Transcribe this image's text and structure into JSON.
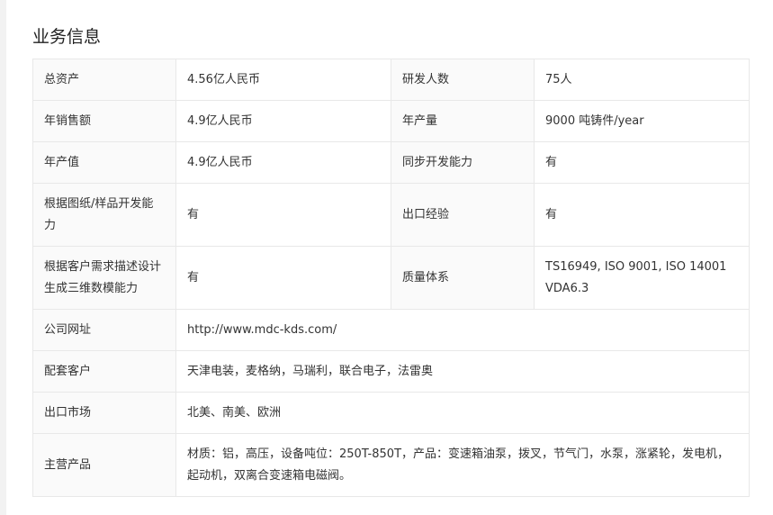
{
  "title": "业务信息",
  "rows": [
    {
      "l1": "总资产",
      "v1": "4.56亿人民币",
      "l2": "研发人数",
      "v2": "75人"
    },
    {
      "l1": "年销售额",
      "v1": "4.9亿人民币",
      "l2": "年产量",
      "v2": "9000 吨铸件/year"
    },
    {
      "l1": "年产值",
      "v1": "4.9亿人民币",
      "l2": "同步开发能力",
      "v2": "有"
    },
    {
      "l1": "根据图纸/样品开发能力",
      "v1": "有",
      "l2": "出口经验",
      "v2": "有"
    },
    {
      "l1": "根据客户需求描述设计生成三维数模能力",
      "v1": "有",
      "l2": "质量体系",
      "v2": "TS16949, ISO 9001, ISO 14001 VDA6.3"
    }
  ],
  "wide": [
    {
      "label": "公司网址",
      "value": "http://www.mdc-kds.com/"
    },
    {
      "label": "配套客户",
      "value": "天津电装，麦格纳，马瑞利，联合电子，法雷奥"
    },
    {
      "label": "出口市场",
      "value": "北美、南美、欧洲"
    },
    {
      "label": "主营产品",
      "value": "材质：铝，高压，设备吨位：250T-850T，产品：变速箱油泵，拨叉，节气门，水泵，涨紧轮，发电机，起动机，双离合变速箱电磁阀。"
    }
  ]
}
